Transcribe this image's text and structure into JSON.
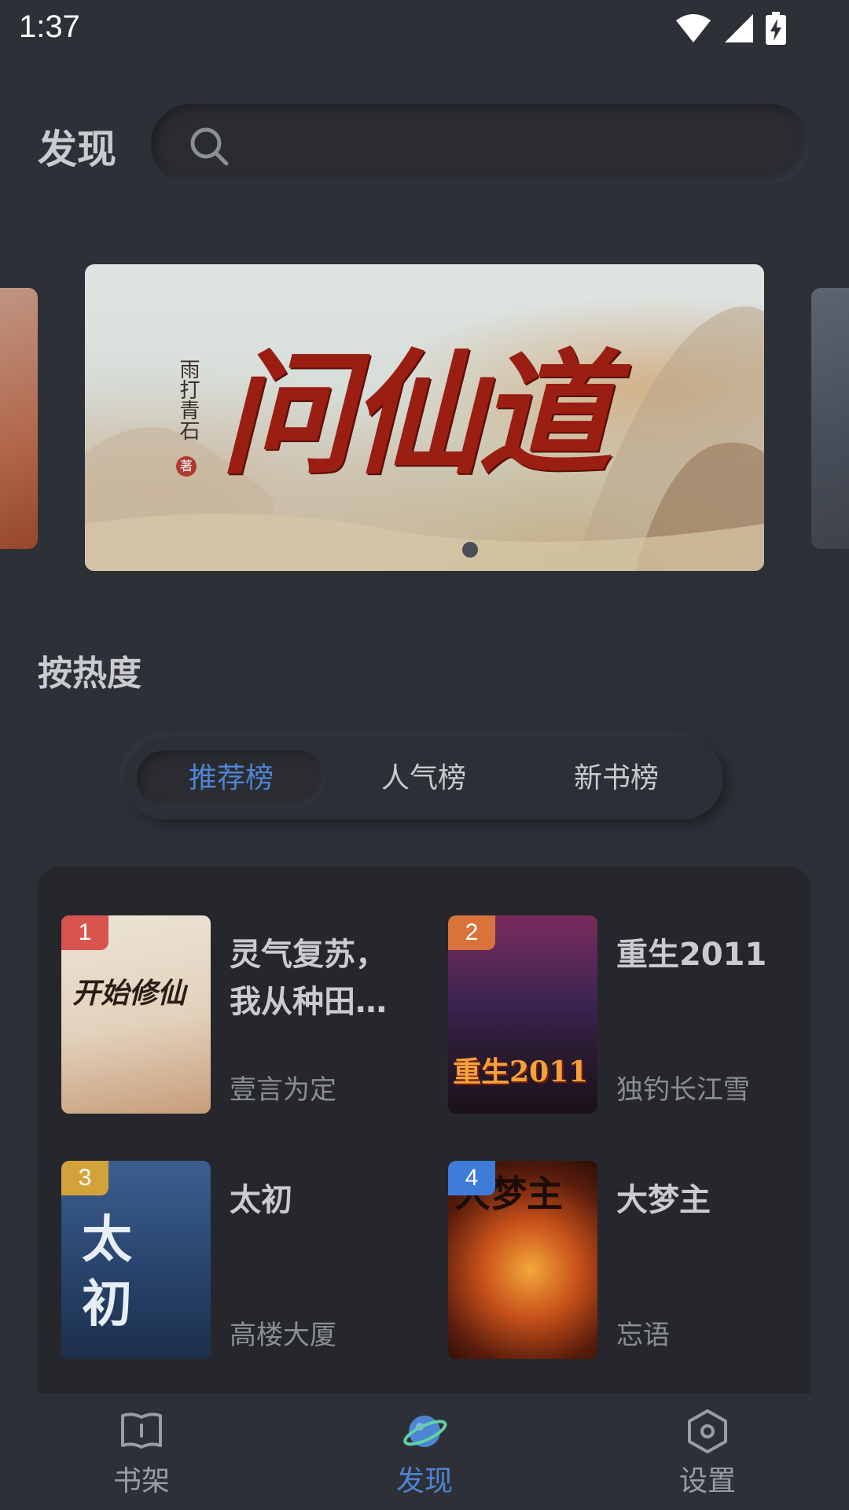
{
  "status": {
    "time": "1:37"
  },
  "header": {
    "title": "发现",
    "search_placeholder": ""
  },
  "banner": {
    "author": "雨打青石",
    "author_seal": "著",
    "title": "问仙道"
  },
  "section": {
    "title": "按热度"
  },
  "tabs": [
    {
      "label": "推荐榜",
      "active": true
    },
    {
      "label": "人气榜",
      "active": false
    },
    {
      "label": "新书榜",
      "active": false
    }
  ],
  "rankings": [
    {
      "rank": "1",
      "title": "灵气复苏，我从种田开始修仙",
      "author": "壹言为定",
      "cover_text": "开始修仙",
      "badge_color": "#d9534f"
    },
    {
      "rank": "2",
      "title": "重生2011",
      "author": "独钓长江雪",
      "cover_text": "重生2011",
      "badge_color": "#d9733b"
    },
    {
      "rank": "3",
      "title": "太初",
      "author": "高楼大厦",
      "cover_text": "太初",
      "badge_color": "#d4a23a"
    },
    {
      "rank": "4",
      "title": "大梦主",
      "author": "忘语",
      "cover_text": "大梦主",
      "badge_color": "#3f7bd8"
    }
  ],
  "nav": [
    {
      "label": "书架",
      "icon": "book-icon",
      "active": false
    },
    {
      "label": "发现",
      "icon": "planet-icon",
      "active": true
    },
    {
      "label": "设置",
      "icon": "settings-hexagon-icon",
      "active": false
    }
  ],
  "colors": {
    "accent": "#4e84d2",
    "background": "#2d3037",
    "card": "#25272c"
  }
}
